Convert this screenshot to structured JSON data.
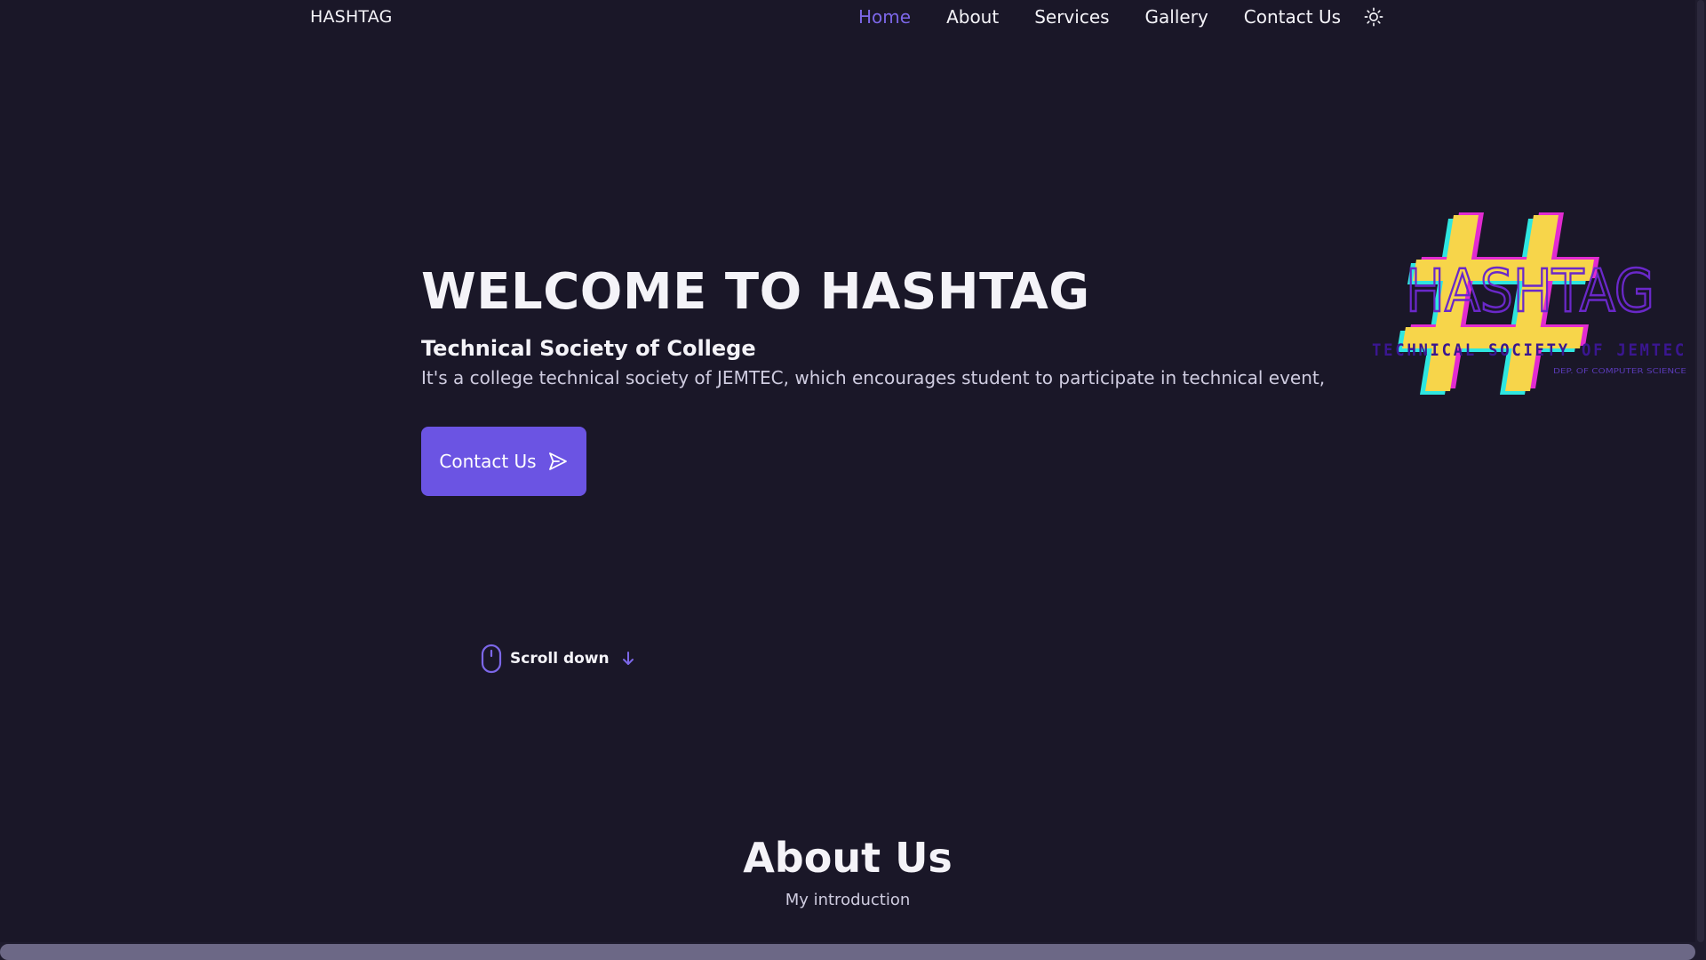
{
  "header": {
    "brand": "HASHTAG",
    "nav": [
      {
        "label": "Home",
        "active": true
      },
      {
        "label": "About",
        "active": false
      },
      {
        "label": "Services",
        "active": false
      },
      {
        "label": "Gallery",
        "active": false
      },
      {
        "label": "Contact Us",
        "active": false
      }
    ],
    "theme_toggle_icon": "sun-icon"
  },
  "hero": {
    "title": "WELCOME TO HASHTAG",
    "subtitle": "Technical Society of College",
    "description": "It's a college technical society of JEMTEC, which encourages student to participate in technical event,",
    "contact_button_label": "Contact Us",
    "contact_button_icon": "send-icon",
    "scroll_down_label": "Scroll down"
  },
  "logo": {
    "word": "HASHTAG",
    "tagline": "TECHNICAL SOCIETY OF JEMTEC",
    "dept": "DEP. OF COMPUTER SCIENCE"
  },
  "about": {
    "title": "About Us",
    "subtitle": "My introduction"
  },
  "colors": {
    "background": "#1a1728",
    "accent": "#7c67e8",
    "button": "#6b54e3",
    "logo_yellow": "#f7d54a",
    "logo_cyan": "#2ee6e0",
    "logo_magenta": "#e22bd0",
    "logo_purple": "#5a1fb8"
  }
}
